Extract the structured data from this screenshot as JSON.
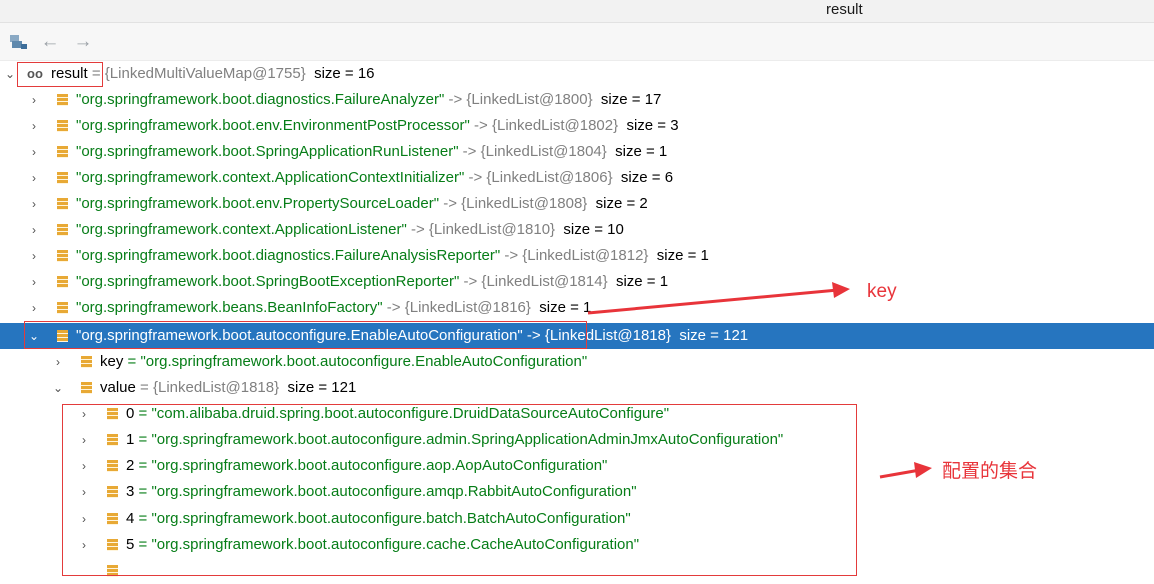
{
  "window": {
    "title": "result"
  },
  "root": {
    "name": "result",
    "eq": " = ",
    "type": "{LinkedMultiValueMap@1755}",
    "size": "size = 16"
  },
  "entries": [
    {
      "key": "\"org.springframework.boot.diagnostics.FailureAnalyzer\"",
      "ref": " -> {LinkedList@1800}",
      "size": "size = 17"
    },
    {
      "key": "\"org.springframework.boot.env.EnvironmentPostProcessor\"",
      "ref": " -> {LinkedList@1802}",
      "size": "size = 3"
    },
    {
      "key": "\"org.springframework.boot.SpringApplicationRunListener\"",
      "ref": " -> {LinkedList@1804}",
      "size": "size = 1"
    },
    {
      "key": "\"org.springframework.context.ApplicationContextInitializer\"",
      "ref": " -> {LinkedList@1806}",
      "size": "size = 6"
    },
    {
      "key": "\"org.springframework.boot.env.PropertySourceLoader\"",
      "ref": " -> {LinkedList@1808}",
      "size": "size = 2"
    },
    {
      "key": "\"org.springframework.context.ApplicationListener\"",
      "ref": " -> {LinkedList@1810}",
      "size": "size = 10"
    },
    {
      "key": "\"org.springframework.boot.diagnostics.FailureAnalysisReporter\"",
      "ref": " -> {LinkedList@1812}",
      "size": "size = 1"
    },
    {
      "key": "\"org.springframework.boot.SpringBootExceptionReporter\"",
      "ref": " -> {LinkedList@1814}",
      "size": "size = 1"
    },
    {
      "key": "\"org.springframework.beans.BeanInfoFactory\"",
      "ref": " -> {LinkedList@1816}",
      "size": "size = 1"
    },
    {
      "key": "\"org.springframework.boot.autoconfigure.EnableAutoConfiguration\"",
      "ref": " -> {LinkedList@1818}",
      "size": "size = 121"
    }
  ],
  "expanded": {
    "key_label": "key",
    "key_value": " = \"org.springframework.boot.autoconfigure.EnableAutoConfiguration\"",
    "value_label": "value",
    "value_eq": " = ",
    "value_type": "{LinkedList@1818}",
    "value_size": "size = 121"
  },
  "items": [
    {
      "index": "0",
      "value": " = \"com.alibaba.druid.spring.boot.autoconfigure.DruidDataSourceAutoConfigure\""
    },
    {
      "index": "1",
      "value": " = \"org.springframework.boot.autoconfigure.admin.SpringApplicationAdminJmxAutoConfiguration\""
    },
    {
      "index": "2",
      "value": " = \"org.springframework.boot.autoconfigure.aop.AopAutoConfiguration\""
    },
    {
      "index": "3",
      "value": " = \"org.springframework.boot.autoconfigure.amqp.RabbitAutoConfiguration\""
    },
    {
      "index": "4",
      "value": " = \"org.springframework.boot.autoconfigure.batch.BatchAutoConfiguration\""
    },
    {
      "index": "5",
      "value": " = \"org.springframework.boot.autoconfigure.cache.CacheAutoConfiguration\""
    }
  ],
  "annotations": {
    "key": "key",
    "collection": "配置的集合"
  },
  "colors": {
    "selection": "#2675bf",
    "string": "#067d17",
    "annotation": "#e8343a"
  },
  "icons": {
    "toolbar": [
      "debug-frame-icon",
      "back-arrow-icon",
      "forward-arrow-icon"
    ]
  }
}
